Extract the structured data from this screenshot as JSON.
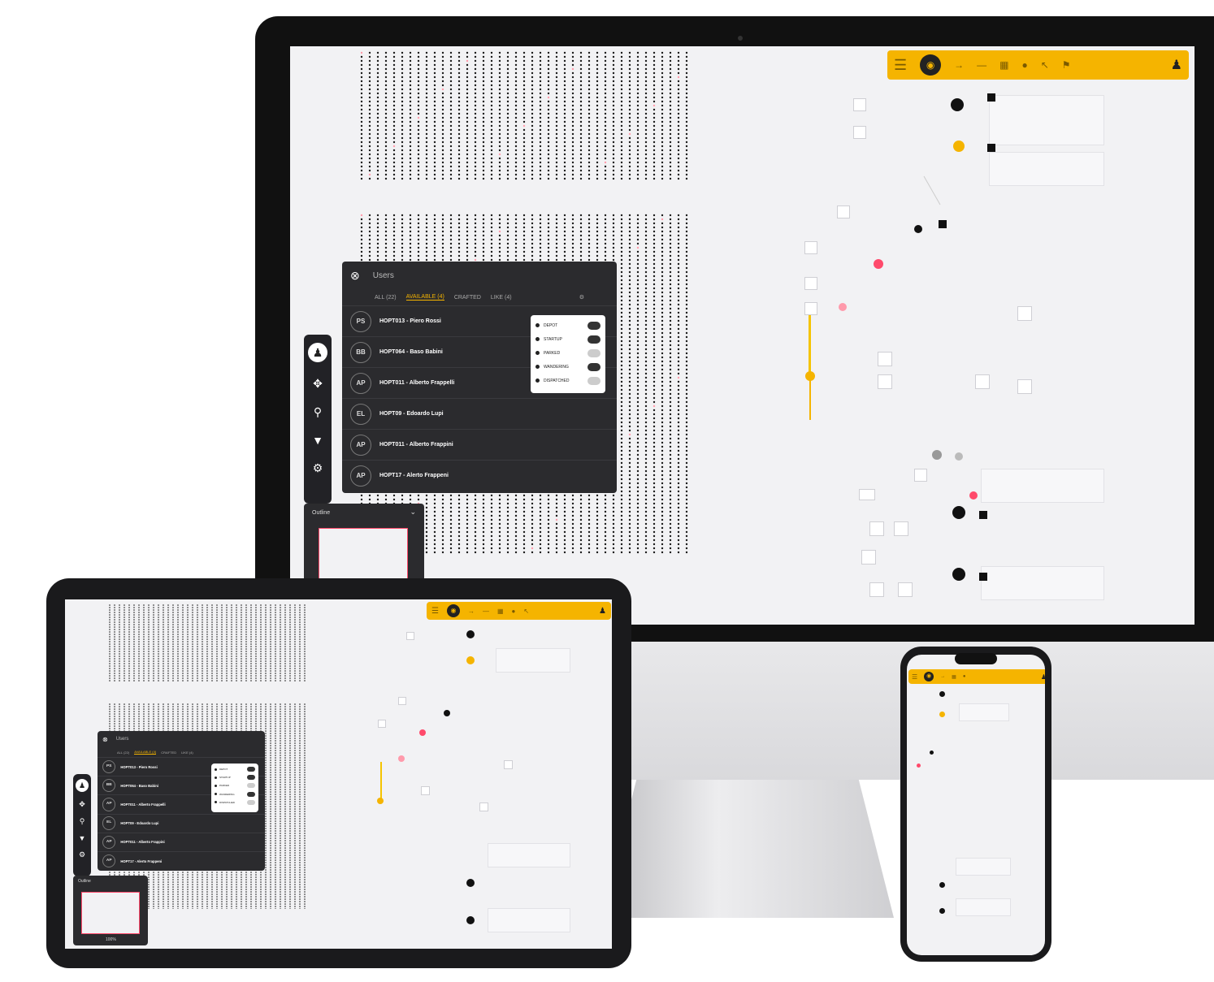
{
  "app": {
    "toolbar": {
      "icons": [
        "menu-icon",
        "logo-icon",
        "arrow-icon",
        "minus-icon",
        "grid-icon",
        "pin-icon",
        "cursor-icon",
        "flag-icon",
        "user-icon"
      ],
      "accent": "#f5b400"
    },
    "panel": {
      "title": "Users",
      "tabs": [
        {
          "label": "ALL (22)",
          "active": false
        },
        {
          "label": "AVAILABLE (4)",
          "active": true
        },
        {
          "label": "CRAFTED",
          "active": false
        },
        {
          "label": "LIKE (4)",
          "active": false
        }
      ],
      "rows": [
        {
          "initials": "PS",
          "name": "HOPT013 - Piero Rossi",
          "sub": ""
        },
        {
          "initials": "BB",
          "name": "HOPT064 - Baso Babini",
          "sub": ""
        },
        {
          "initials": "AP",
          "name": "HOPT011 - Alberto Frappelli",
          "sub": ""
        },
        {
          "initials": "EL",
          "name": "HOPT09 - Edoardo Lupi",
          "sub": ""
        },
        {
          "initials": "AP",
          "name": "HOPT011 - Alberto Frappini",
          "sub": ""
        },
        {
          "initials": "AP",
          "name": "HOPT17 - Alerto Frappeni",
          "sub": ""
        }
      ],
      "popover": [
        {
          "label": "DEPOT",
          "on": true
        },
        {
          "label": "STARTUP",
          "on": true
        },
        {
          "label": "PARKED",
          "on": false
        },
        {
          "label": "WANDERING",
          "on": true
        },
        {
          "label": "DISPATCHED",
          "on": false
        }
      ]
    },
    "rail_icons": [
      "user-icon",
      "move-icon",
      "search-icon",
      "pin-icon",
      "settings-icon"
    ],
    "minimap": {
      "title": "Outline",
      "zoom": "100%"
    }
  }
}
